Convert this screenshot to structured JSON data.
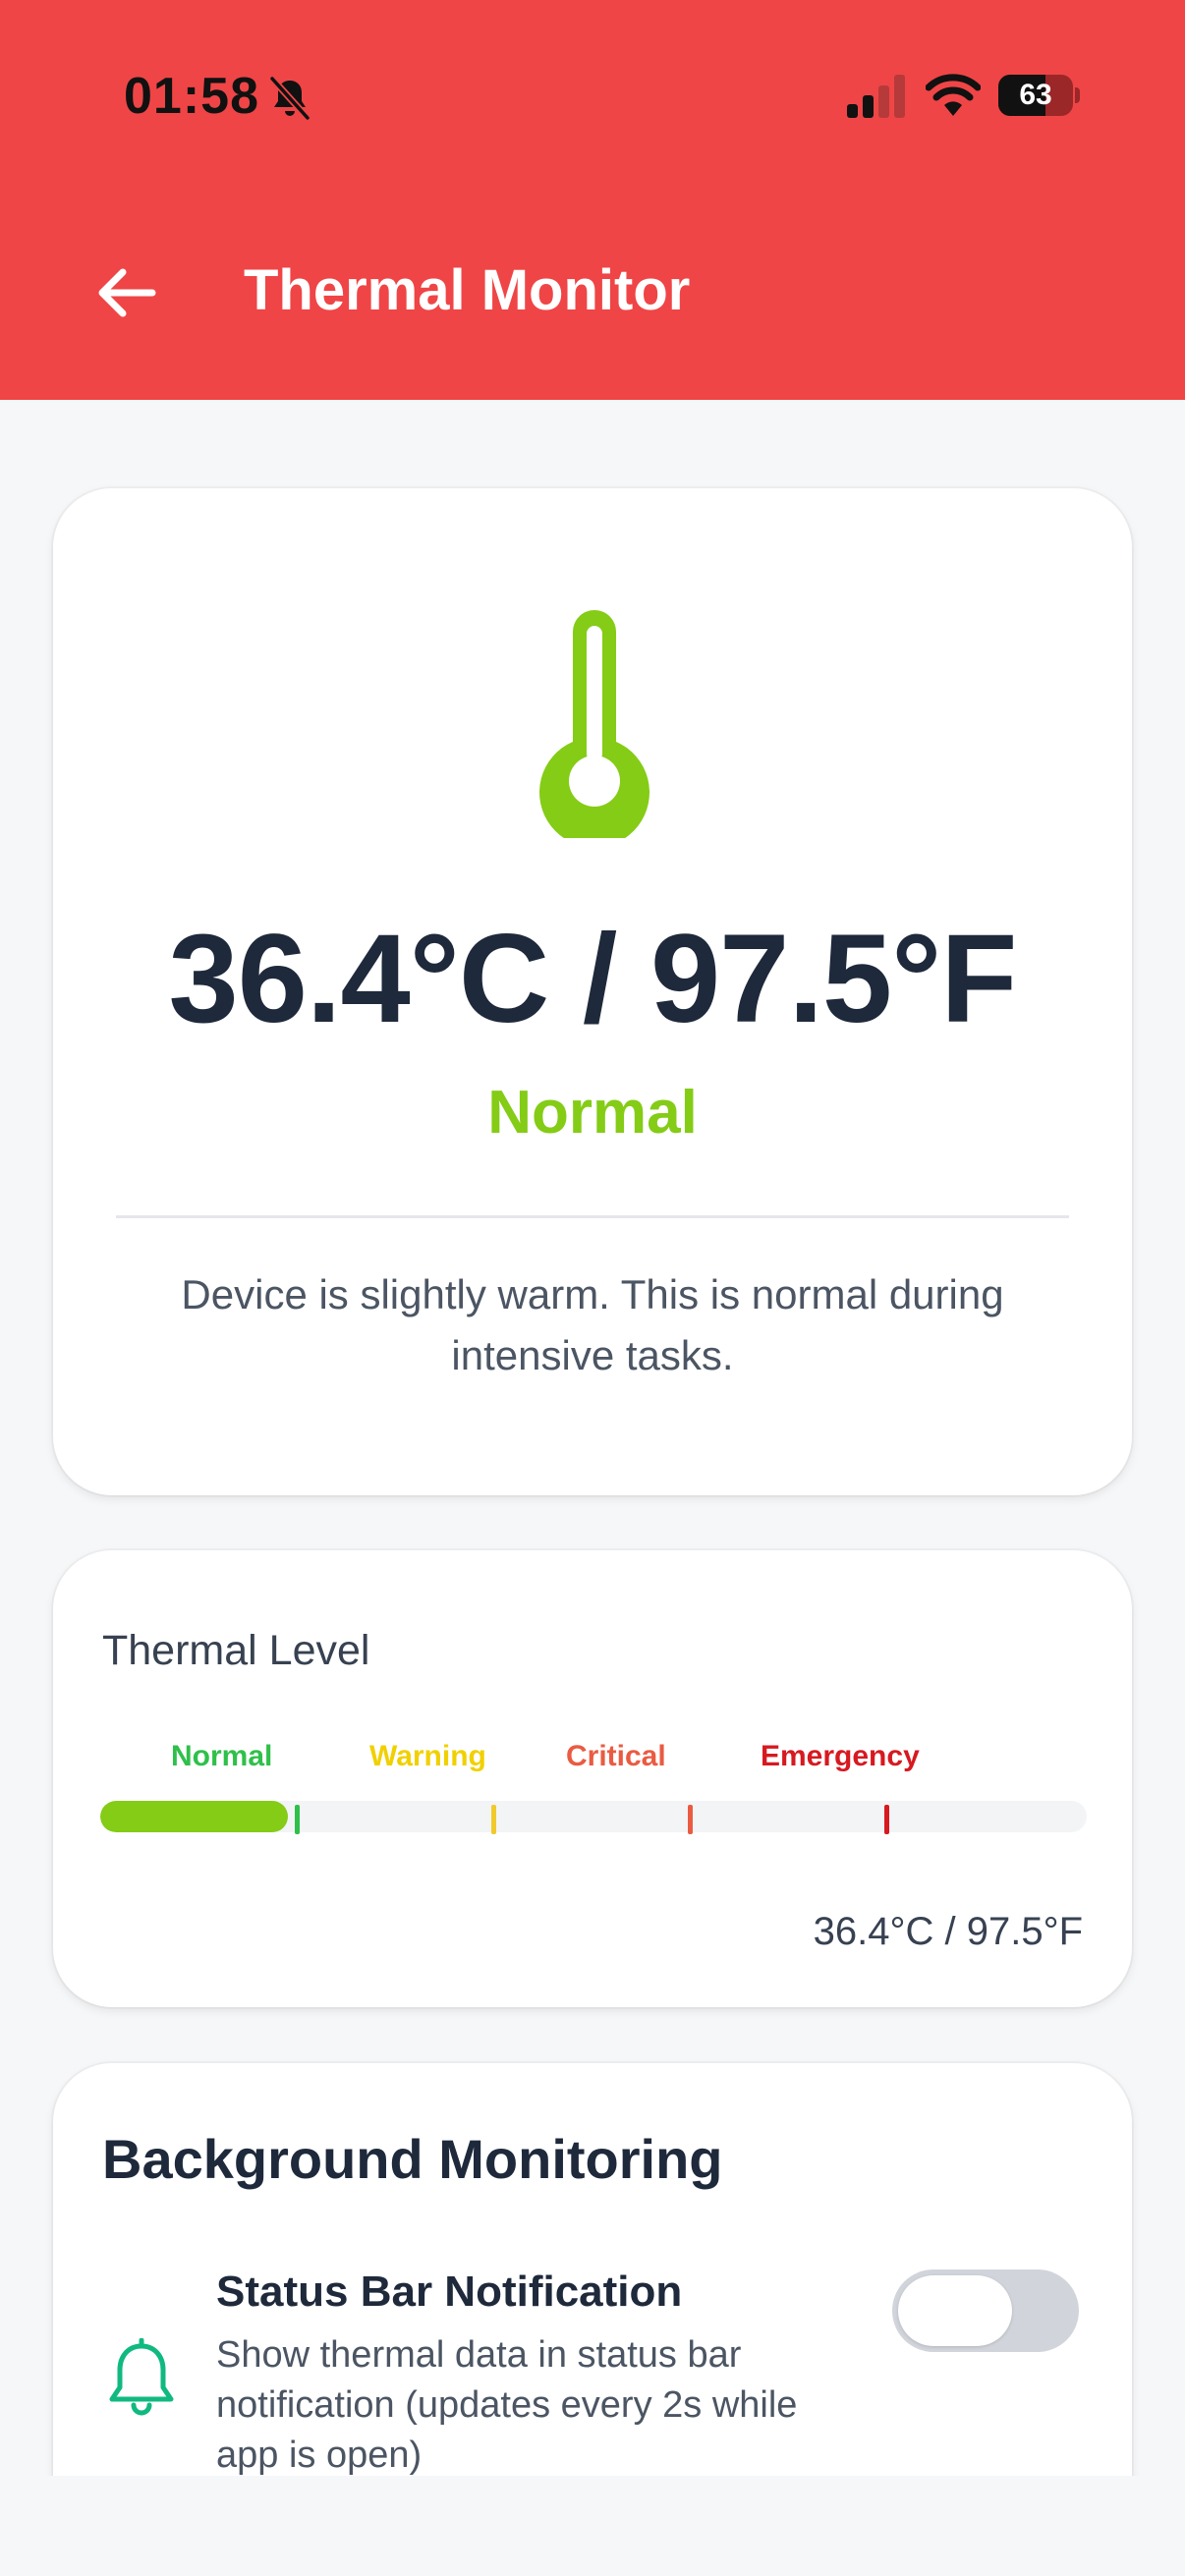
{
  "status_bar": {
    "time": "01:58",
    "battery_level": "63",
    "battery_fraction": 0.63
  },
  "header": {
    "title": "Thermal Monitor",
    "back_icon": "arrow-left-icon",
    "background_color": "#ef4546"
  },
  "temperature_card": {
    "icon": "thermometer-icon",
    "reading": "36.4°C / 97.5°F",
    "status": "Normal",
    "status_color": "#84cc16",
    "description": "Device is slightly warm. This is normal during intensive tasks."
  },
  "thermal_level": {
    "title": "Thermal Level",
    "levels": [
      {
        "label": "Normal",
        "color": "#2fc04b"
      },
      {
        "label": "Warning",
        "color": "#f1d000"
      },
      {
        "label": "Critical",
        "color": "#ea5b42"
      },
      {
        "label": "Emergency",
        "color": "#d71920"
      }
    ],
    "fill_fraction": 0.19,
    "fill_color": "#84cc16",
    "reading": "36.4°C / 97.5°F"
  },
  "background_monitoring": {
    "title": "Background Monitoring",
    "items": [
      {
        "icon": "bell-icon",
        "title": "Status Bar Notification",
        "description": "Show thermal data in status bar notification (updates every 2s while app is open)",
        "enabled": false
      }
    ]
  }
}
